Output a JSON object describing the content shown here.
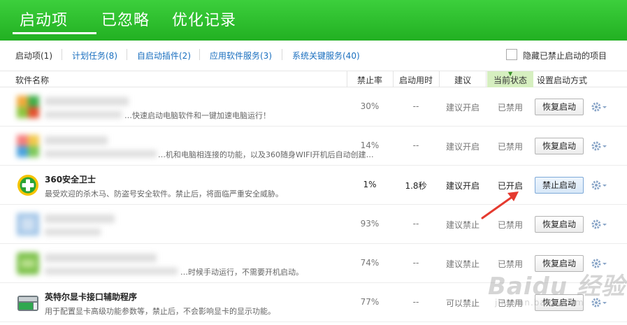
{
  "header": {
    "tabs": [
      {
        "label": "启动项"
      },
      {
        "label": "已忽略"
      },
      {
        "label": "优化记录"
      }
    ]
  },
  "subtabs": [
    {
      "label": "启动项(1)"
    },
    {
      "label": "计划任务(8)"
    },
    {
      "label": "自启动插件(2)"
    },
    {
      "label": "应用软件服务(3)"
    },
    {
      "label": "系统关键服务(40)"
    }
  ],
  "hide_disabled_label": "隐藏已禁止启动的项目",
  "columns": {
    "name": "软件名称",
    "rate": "禁止率",
    "time": "启动用时",
    "advice": "建议",
    "state": "当前状态",
    "action": "设置启动方式"
  },
  "rows": [
    {
      "name": "",
      "desc": "…快速启动电脑软件和一键加速电脑运行！",
      "rate": "30%",
      "time": "--",
      "advice": "建议开启",
      "state": "已禁用",
      "button": "恢复启动"
    },
    {
      "name": "",
      "desc": "…机和电脑相连接的功能，以及360随身WIFI开机后自动创建…",
      "rate": "14%",
      "time": "--",
      "advice": "建议开启",
      "state": "已禁用",
      "button": "恢复启动"
    },
    {
      "name": "360安全卫士",
      "desc": "最受欢迎的杀木马、防盗号安全软件。禁止后，将面临严重安全威胁。",
      "rate": "1%",
      "time": "1.8秒",
      "advice": "建议开启",
      "state": "已开启",
      "button": "禁止启动"
    },
    {
      "name": "",
      "desc": "",
      "rate": "93%",
      "time": "--",
      "advice": "建议禁止",
      "state": "已禁用",
      "button": "恢复启动"
    },
    {
      "name": "",
      "desc": "…时候手动运行，不需要开机启动。",
      "rate": "74%",
      "time": "--",
      "advice": "建议禁止",
      "state": "已禁用",
      "button": "恢复启动"
    },
    {
      "name": "英特尔显卡接口辅助程序",
      "desc": "用于配置显卡高级功能参数等，禁止后，不会影响显卡的显示功能。",
      "rate": "77%",
      "time": "--",
      "advice": "可以禁止",
      "state": "已禁用",
      "button": "恢复启动"
    }
  ],
  "watermark": {
    "text": "Baidu 经验",
    "sub": "jingyan.baidu.com"
  },
  "colors": {
    "brand_green": "#2bbf2b",
    "link_blue": "#1a6fbf",
    "arrow_red": "#e53a2f"
  }
}
